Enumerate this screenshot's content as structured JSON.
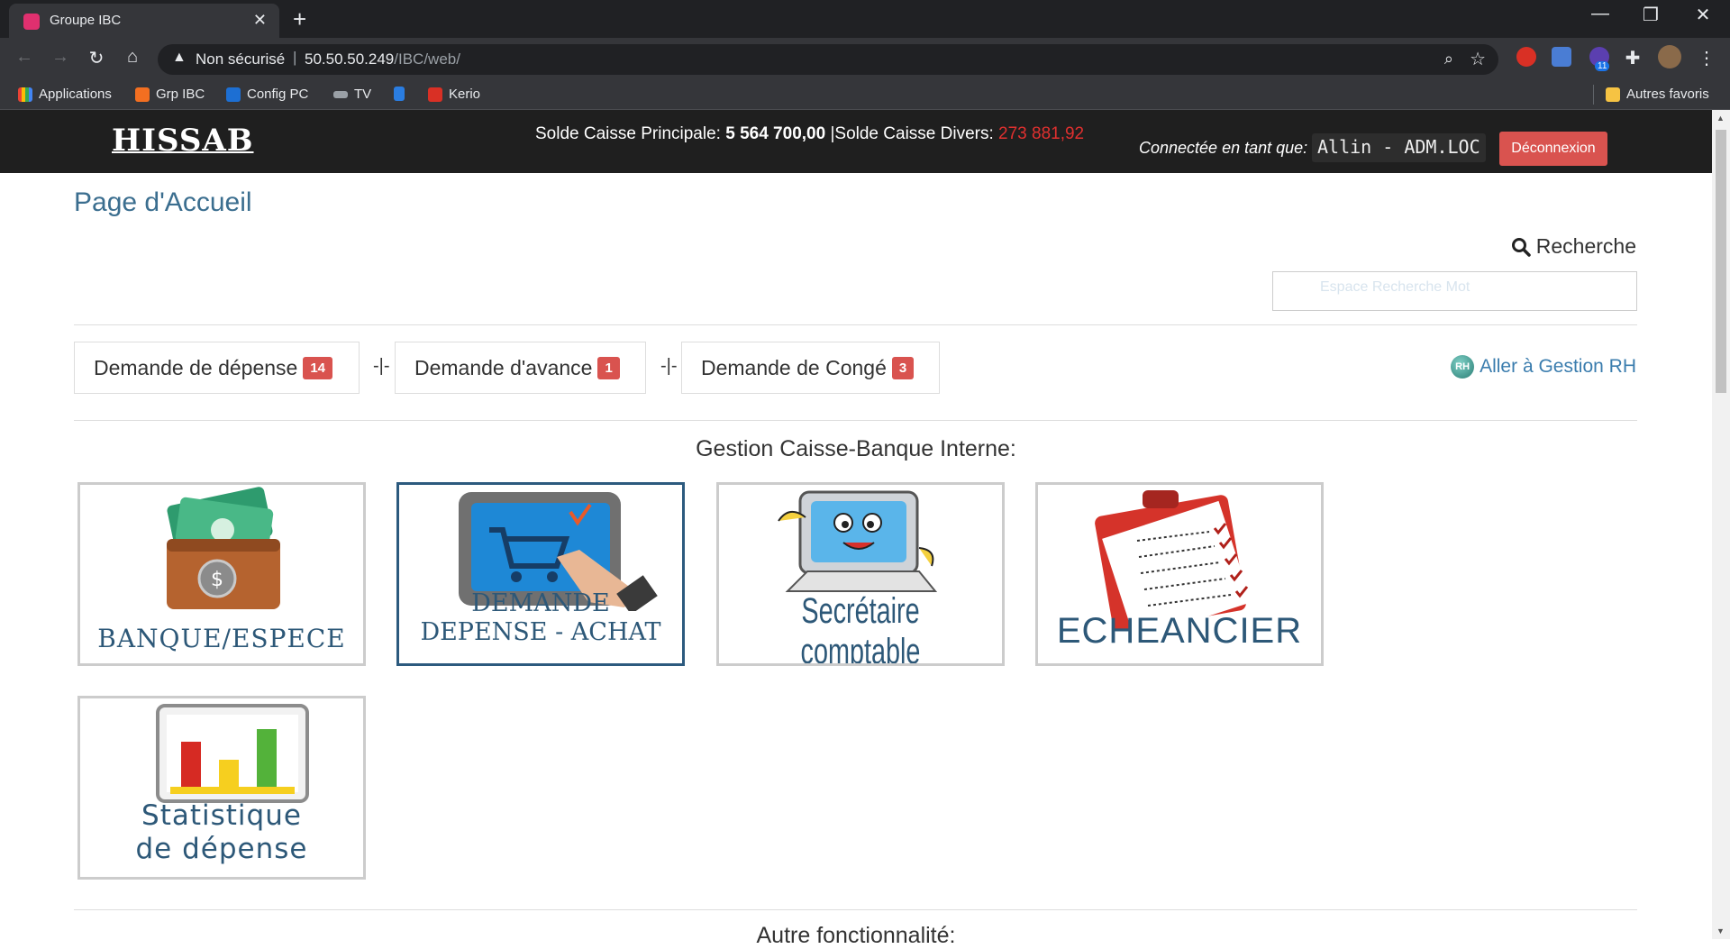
{
  "browser": {
    "tab_title": "Groupe IBC",
    "address_warning": "Non sécurisé",
    "address_host": "50.50.50.249",
    "address_path": "/IBC/web/",
    "bookmarks": [
      "Applications",
      "Grp IBC",
      "Config PC",
      "TV",
      "",
      "Kerio"
    ],
    "other_bookmarks": "Autres favoris",
    "extension_badge": "11"
  },
  "header": {
    "logo": "HISSAB",
    "solde_principale_label": "Solde Caisse Principale:",
    "solde_principale_value": "5 564 700,00",
    "solde_divers_label": "|Solde Caisse Divers:",
    "solde_divers_value": "273 881,92",
    "connected_label": "Connectée en tant que:",
    "user": "Allin - ADM.LOC",
    "logout_label": "Déconnexion"
  },
  "page": {
    "title": "Page d'Accueil",
    "search_label": "Recherche",
    "search_placeholder": "Espace Recherche Mot"
  },
  "requests": [
    {
      "label": "Demande de dépense",
      "count": "14"
    },
    {
      "label": "Demande d'avance",
      "count": "1"
    },
    {
      "label": "Demande de Congé",
      "count": "3"
    }
  ],
  "request_separator": "-|-",
  "rh_link": "Aller à Gestion RH",
  "rh_icon_text": "RH",
  "section_title": "Gestion Caisse-Banque Interne:",
  "tiles": {
    "banque": "BANQUE/ESPECE",
    "demande_line1": "DEMANDE",
    "demande_line2": "DEPENSE - ACHAT",
    "secretaire": "Secrétaire comptable",
    "echeancier": "ECHEANCIER",
    "stat_line1": "Statistique",
    "stat_line2": "de dépense"
  },
  "next_section_title": "Autre fonctionnalité:",
  "colors": {
    "header_bg": "#1f1f1f",
    "accent_red": "#d9534f",
    "title_blue": "#3b6e8f",
    "tile_text": "#2d5878"
  }
}
